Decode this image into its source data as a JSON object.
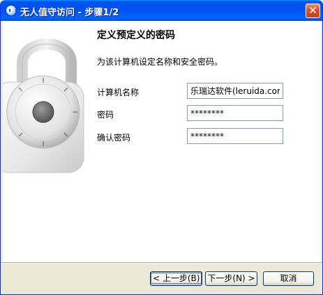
{
  "window": {
    "title": "无人值守访问 - 步骤1/2",
    "icon": "teamviewer-icon",
    "close_label": "✕"
  },
  "page": {
    "heading": "定义预定义的密码",
    "description": "为该计算机设定名称和安全密码。"
  },
  "form": {
    "computer_name": {
      "label": "计算机名称",
      "value": "乐瑞达软件(leruida.com)"
    },
    "password": {
      "label": "密码",
      "value": "********"
    },
    "confirm_password": {
      "label": "确认密码",
      "value": "********"
    }
  },
  "buttons": {
    "back": "< 上一步(B)",
    "next": "下一步(N) >",
    "cancel": "取消"
  },
  "colors": {
    "titlebar": "#0054e3",
    "window_bg": "#ece9d8",
    "close_button": "#d6512c",
    "field_border": "#7f9db9"
  }
}
